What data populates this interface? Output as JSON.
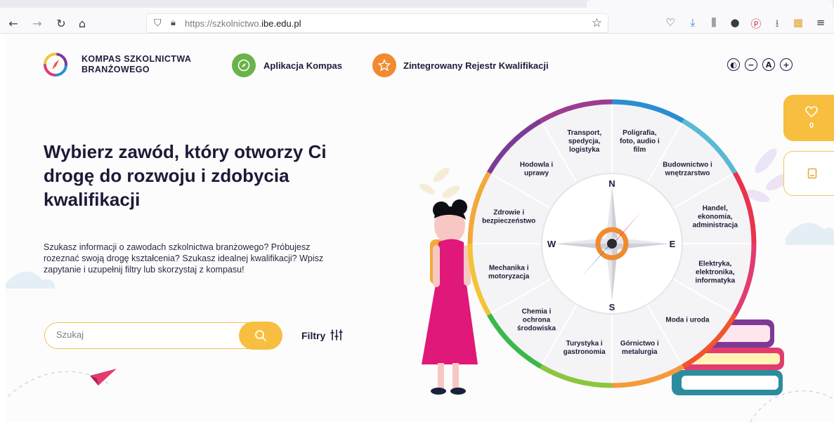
{
  "browser": {
    "url_prefix": "https://szkolnictwo.",
    "url_domain": "ibe.edu.pl"
  },
  "header": {
    "brand_line1": "KOMPAS SZKOLNICTWA",
    "brand_line2": "BRANŻOWEGO",
    "link_app": "Aplikacja Kompas",
    "link_register": "Zintegrowany Rejestr Kwalifikacji",
    "a11y": [
      "contrast-icon",
      "zoom-out-icon",
      "font-size-icon",
      "zoom-in-icon"
    ]
  },
  "hero": {
    "headline": "Wybierz zawód, który otworzy Ci drogę do rozwoju i zdobycia kwalifikacji",
    "lead": "Szukasz informacji o zawodach szkolnictwa branżowego? Próbujesz rozeznać swoją drogę kształcenia? Szukasz idealnej kwalifikacji? Wpisz zapytanie i uzupełnij filtry lub skorzystaj z kompasu!"
  },
  "search": {
    "placeholder": "Szukaj",
    "filters_label": "Filtry"
  },
  "favorites": {
    "count": "0"
  },
  "compass": {
    "directions": {
      "n": "N",
      "e": "E",
      "s": "S",
      "w": "W"
    },
    "sectors": [
      [
        "Poligrafia,",
        "foto, audio i",
        "film"
      ],
      [
        "Budownictwo i",
        "wnętrzarstwo"
      ],
      [
        "Handel,",
        "ekonomia,",
        "administracja"
      ],
      [
        "Elektryka,",
        "elektronika,",
        "informatyka"
      ],
      [
        "Moda i uroda"
      ],
      [
        "Górnictwo i",
        "metalurgia"
      ],
      [
        "Turystyka i",
        "gastronomia"
      ],
      [
        "Chemia i",
        "ochrona",
        "środowiska"
      ],
      [
        "Mechanika i",
        "motoryzacja"
      ],
      [
        "Zdrowie i",
        "bezpieczeństwo"
      ],
      [
        "Hodowla i",
        "uprawy"
      ],
      [
        "Transport,",
        "spedycja,",
        "logistyka"
      ]
    ],
    "ring_colors": [
      "#2a8fd0",
      "#5ab9d4",
      "#e8344e",
      "#e23c6f",
      "#f2552e",
      "#f59a3b",
      "#8cc63f",
      "#3cb84b",
      "#f4c437",
      "#f3a93a",
      "#7d3a95",
      "#9c3c8f"
    ]
  }
}
